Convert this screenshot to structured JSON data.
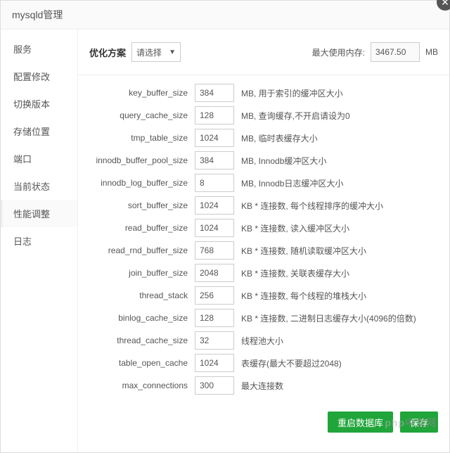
{
  "header": {
    "title": "mysqld管理"
  },
  "close": "✕",
  "sidebar": {
    "items": [
      {
        "label": "服务"
      },
      {
        "label": "配置修改"
      },
      {
        "label": "切换版本"
      },
      {
        "label": "存储位置"
      },
      {
        "label": "端口"
      },
      {
        "label": "当前状态"
      },
      {
        "label": "性能调整"
      },
      {
        "label": "日志"
      }
    ],
    "activeIndex": 6
  },
  "top": {
    "plan_label": "优化方案",
    "plan_selected": "请选择",
    "maxmem_label": "最大使用内存:",
    "maxmem_value": "3467.50",
    "maxmem_unit": "MB"
  },
  "rows": [
    {
      "label": "key_buffer_size",
      "value": "384",
      "desc": "MB, 用于索引的缓冲区大小"
    },
    {
      "label": "query_cache_size",
      "value": "128",
      "desc": "MB, 查询缓存,不开启请设为0"
    },
    {
      "label": "tmp_table_size",
      "value": "1024",
      "desc": "MB, 临时表缓存大小"
    },
    {
      "label": "innodb_buffer_pool_size",
      "value": "384",
      "desc": "MB, Innodb缓冲区大小"
    },
    {
      "label": "innodb_log_buffer_size",
      "value": "8",
      "desc": "MB, Innodb日志缓冲区大小"
    },
    {
      "label": "sort_buffer_size",
      "value": "1024",
      "desc": "KB * 连接数, 每个线程排序的缓冲大小"
    },
    {
      "label": "read_buffer_size",
      "value": "1024",
      "desc": "KB * 连接数, 读入缓冲区大小"
    },
    {
      "label": "read_rnd_buffer_size",
      "value": "768",
      "desc": "KB * 连接数, 随机读取缓冲区大小"
    },
    {
      "label": "join_buffer_size",
      "value": "2048",
      "desc": "KB * 连接数, 关联表缓存大小"
    },
    {
      "label": "thread_stack",
      "value": "256",
      "desc": "KB * 连接数, 每个线程的堆栈大小"
    },
    {
      "label": "binlog_cache_size",
      "value": "128",
      "desc": "KB * 连接数, 二进制日志缓存大小(4096的倍数)"
    },
    {
      "label": "thread_cache_size",
      "value": "32",
      "desc": "  线程池大小"
    },
    {
      "label": "table_open_cache",
      "value": "1024",
      "desc": "  表缓存(最大不要超过2048)"
    },
    {
      "label": "max_connections",
      "value": "300",
      "desc": "  最大连接数"
    }
  ],
  "footer": {
    "restart": "重启数据库",
    "save": "保存"
  },
  "watermark_a": "php",
  "watermark_b": "中文网"
}
